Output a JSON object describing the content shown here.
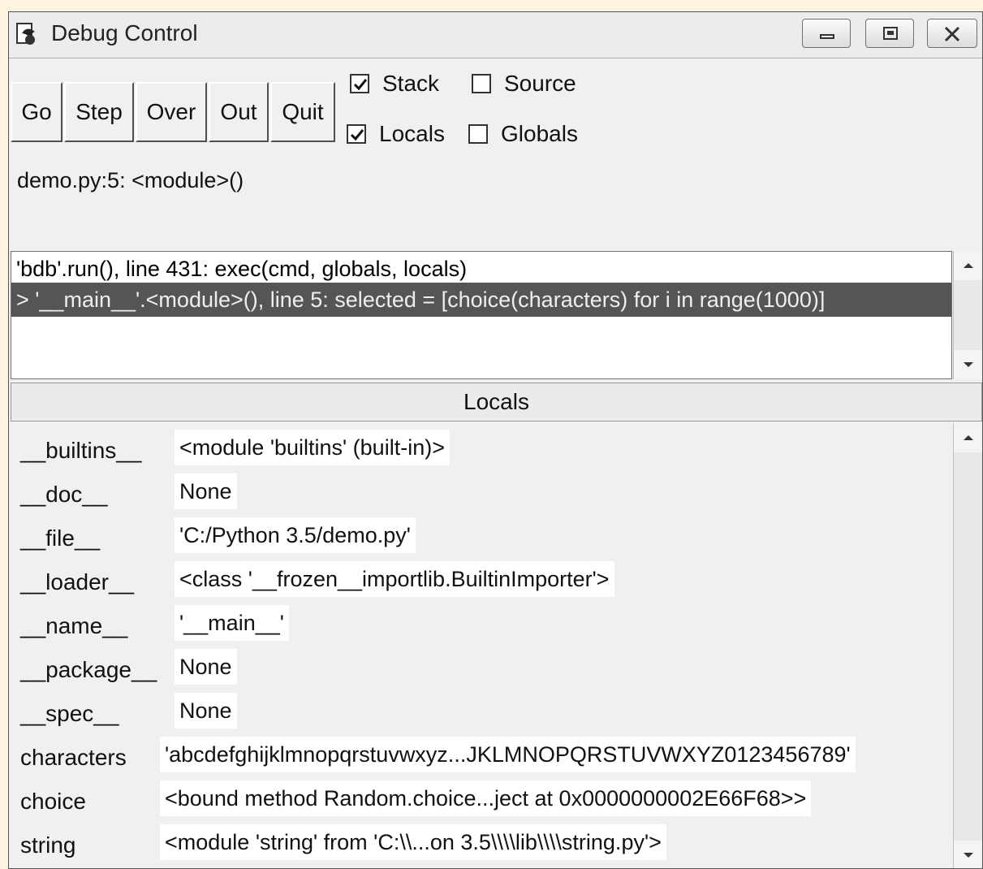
{
  "window": {
    "title": "Debug Control"
  },
  "toolbar": {
    "buttons": [
      "Go",
      "Step",
      "Over",
      "Out",
      "Quit"
    ]
  },
  "checkboxes": {
    "stack": {
      "label": "Stack",
      "checked": true
    },
    "source": {
      "label": "Source",
      "checked": false
    },
    "locals": {
      "label": "Locals",
      "checked": true
    },
    "globals": {
      "label": "Globals",
      "checked": false
    }
  },
  "status": "demo.py:5: <module>()",
  "stack": [
    {
      "text": "'bdb'.run(), line 431: exec(cmd, globals, locals)",
      "selected": false
    },
    {
      "text": "> '__main__'.<module>(), line 5: selected = [choice(characters) for i in range(1000)]",
      "selected": true
    }
  ],
  "locals_panel": {
    "title": "Locals",
    "variables": [
      {
        "name": "__builtins__",
        "value": "<module 'builtins' (built-in)>"
      },
      {
        "name": "__doc__",
        "value": "None"
      },
      {
        "name": "__file__",
        "value": "'C:/Python 3.5/demo.py'"
      },
      {
        "name": "__loader__",
        "value": "<class '__frozen__importlib.BuiltinImporter'>"
      },
      {
        "name": "__name__",
        "value": "'__main__'"
      },
      {
        "name": "__package__",
        "value": "None"
      },
      {
        "name": "__spec__",
        "value": "None"
      },
      {
        "name": "characters",
        "value": "'abcdefghijklmnopqrstuvwxyz...JKLMNOPQRSTUVWXYZ0123456789'"
      },
      {
        "name": "choice",
        "value": "<bound method Random.choice...ject at 0x0000000002E66F68>>"
      },
      {
        "name": "string",
        "value": "<module 'string' from 'C:\\\\...on 3.5\\\\\\\\lib\\\\\\\\string.py'>"
      }
    ]
  },
  "icons": {
    "app": "python-tk-icon",
    "minimize": "minimize-icon",
    "maximize": "maximize-icon",
    "close": "close-icon",
    "scroll_up": "arrow-up-icon",
    "scroll_down": "arrow-down-icon"
  }
}
